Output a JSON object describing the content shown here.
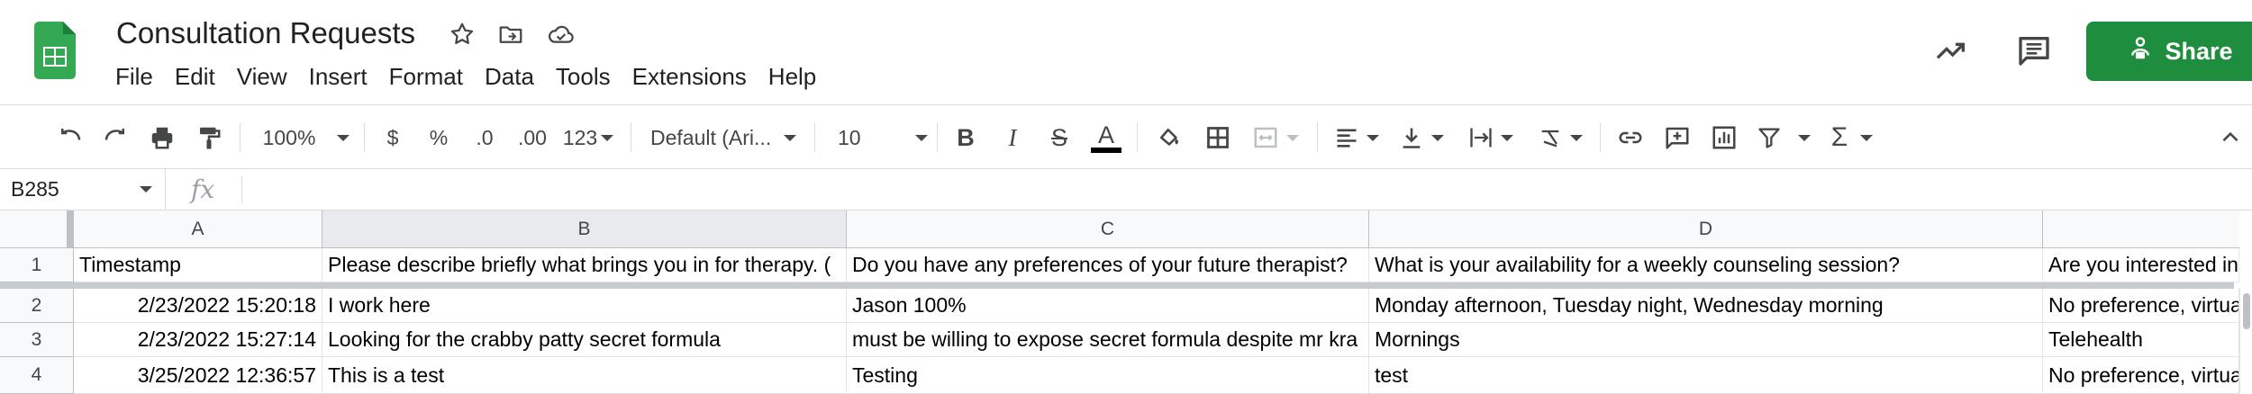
{
  "app": {
    "doc_title": "Consultation Requests",
    "menu": [
      "File",
      "Edit",
      "View",
      "Insert",
      "Format",
      "Data",
      "Tools",
      "Extensions",
      "Help"
    ],
    "share_label": "Share",
    "accent_color": "#1e8e3e"
  },
  "toolbar": {
    "zoom": "100%",
    "currency": "$",
    "percent": "%",
    "dec_decrease": ".0",
    "dec_increase": ".00",
    "more_formats": "123",
    "font_family": "Default (Ari...",
    "font_size": "10",
    "icons": [
      "undo-icon",
      "redo-icon",
      "print-icon",
      "paint-format-icon",
      "bold-icon",
      "italic-icon",
      "strikethrough-icon",
      "text-color-icon",
      "fill-color-icon",
      "borders-icon",
      "merge-cells-icon",
      "align-horizontal-icon",
      "align-vertical-icon",
      "text-wrap-icon",
      "text-rotate-icon",
      "link-icon",
      "comment-icon",
      "chart-icon",
      "filter-icon",
      "functions-icon",
      "collapse-icon"
    ]
  },
  "formula_bar": {
    "cell_ref": "B285",
    "fx": "fx",
    "value": ""
  },
  "sheet": {
    "columns": [
      "A",
      "B",
      "C",
      "D",
      "E"
    ],
    "selected_column": "B",
    "row_numbers": [
      "1",
      "2",
      "3",
      "4"
    ],
    "rows": [
      [
        "Timestamp",
        "Please describe briefly what brings you in for therapy. (",
        "Do you have any preferences of your future therapist?",
        "What is your availability for a weekly counseling session?",
        "Are you interested in"
      ],
      [
        "2/23/2022 15:20:18",
        "I work here",
        "Jason 100%",
        "Monday afternoon, Tuesday night, Wednesday morning",
        "No preference, virtua"
      ],
      [
        "2/23/2022 15:27:14",
        "Looking for the crabby patty secret formula",
        "must be willing to expose secret formula despite mr kra",
        "Mornings",
        "Telehealth"
      ],
      [
        "3/25/2022 12:36:57",
        "This is a test",
        "Testing",
        "test",
        "No preference, virtua"
      ]
    ]
  }
}
